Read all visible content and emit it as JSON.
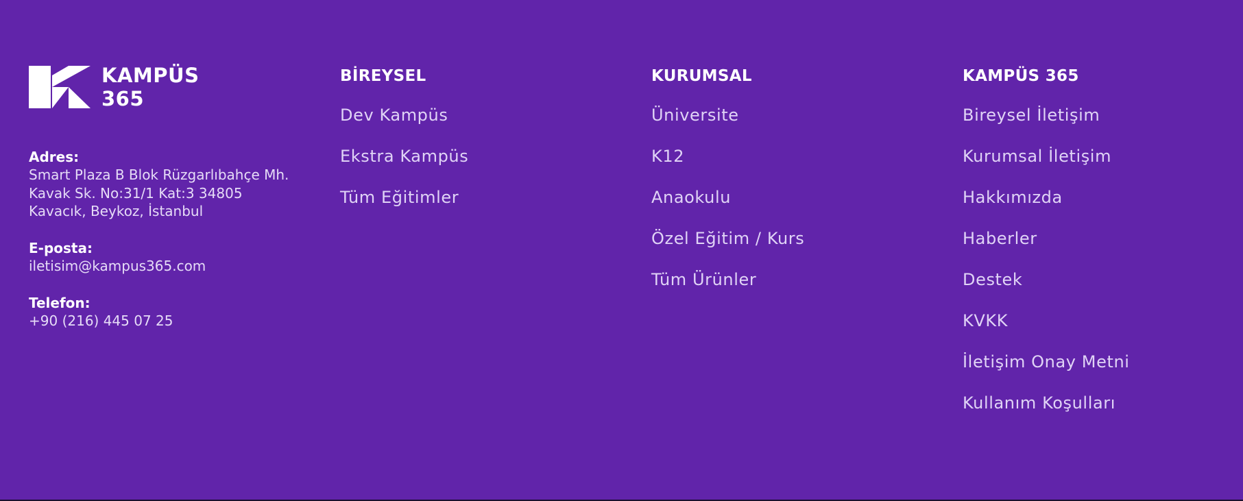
{
  "brand": {
    "line1": "KAMPÜS",
    "line2": "365",
    "color": "#6124aa"
  },
  "contact": {
    "address_label": "Adres:",
    "address_lines": [
      "Smart Plaza B Blok Rüzgarlıbahçe Mh.",
      "Kavak Sk. No:31/1 Kat:3 34805",
      "Kavacık, Beykoz, İstanbul"
    ],
    "email_label": "E-posta:",
    "email": "iletisim@kampus365.com",
    "phone_label": "Telefon:",
    "phone": "+90 (216) 445 07 25"
  },
  "columns": {
    "bireysel": {
      "title": "BİREYSEL",
      "links": [
        "Dev Kampüs",
        "Ekstra Kampüs",
        "Tüm Eğitimler"
      ]
    },
    "kurumsal": {
      "title": "KURUMSAL",
      "links": [
        "Üniversite",
        "K12",
        "Anaokulu",
        "Özel Eğitim / Kurs",
        "Tüm Ürünler"
      ]
    },
    "kampus365": {
      "title": "KAMPÜS 365",
      "links": [
        "Bireysel İletişim",
        "Kurumsal İletişim",
        "Hakkımızda",
        "Haberler",
        "Destek",
        "KVKK",
        "İletişim Onay Metni",
        "Kullanım Koşulları"
      ]
    }
  }
}
